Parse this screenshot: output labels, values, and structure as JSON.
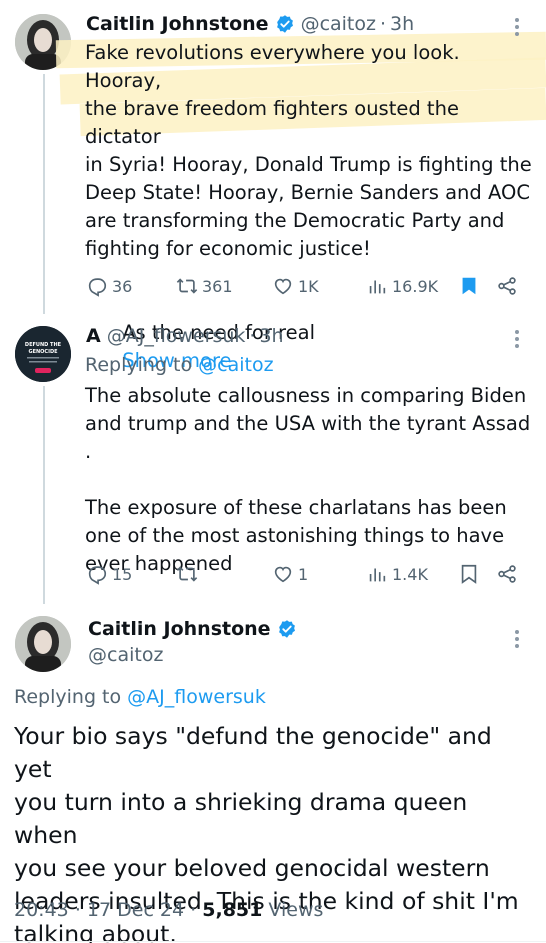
{
  "tweet1": {
    "name": "Caitlin Johnstone",
    "handle": "@caitoz",
    "separator": "·",
    "time": "3h",
    "text_lines": [
      "Fake revolutions everywhere you look. Hooray,",
      "the brave freedom fighters ousted the dictator",
      "in Syria! Hooray, Donald Trump is fighting the",
      "Deep State! Hooray, Bernie Sanders and AOC",
      "are transforming the Democratic Party and",
      "fighting for economic justice!"
    ],
    "text_tail": "As the need for real",
    "show_more": "Show more",
    "replies": "36",
    "retweets": "361",
    "likes": "1K",
    "views": "16.9K",
    "bookmarked": true
  },
  "tweet2": {
    "name": "A",
    "handle": "@AJ_flowersuk",
    "separator": "·",
    "time": "3h",
    "replying_label": "Replying to",
    "replying_handle": "@caitoz",
    "text_lines": [
      "The absolute callousness in comparing Biden",
      "and trump and the USA with the tyrant Assad ."
    ],
    "text_lines2": [
      "The exposure of these charlatans has been",
      "one of the most astonishing things to have",
      "ever happened"
    ],
    "avatar_text_1": "DEFUND THE",
    "avatar_text_2": "GENOCIDE",
    "replies": "15",
    "retweets": "",
    "likes": "1",
    "views": "1.4K"
  },
  "tweet3": {
    "name": "Caitlin Johnstone",
    "handle": "@caitoz",
    "replying_label": "Replying to",
    "replying_handle": "@AJ_flowersuk",
    "text_lines": [
      "Your bio says \"defund the genocide\" and yet",
      "you turn into a shrieking drama queen when",
      "you see your beloved genocidal western",
      "leaders insulted. This is the kind of shit I'm",
      "talking about."
    ],
    "time": "20:43",
    "date": "17 Dec 24",
    "separator": "·",
    "views_count": "5,851",
    "views_label": "Views"
  },
  "colors": {
    "accent": "#1d9bf0",
    "muted": "#536471",
    "highlight": "#fdf1c3"
  }
}
